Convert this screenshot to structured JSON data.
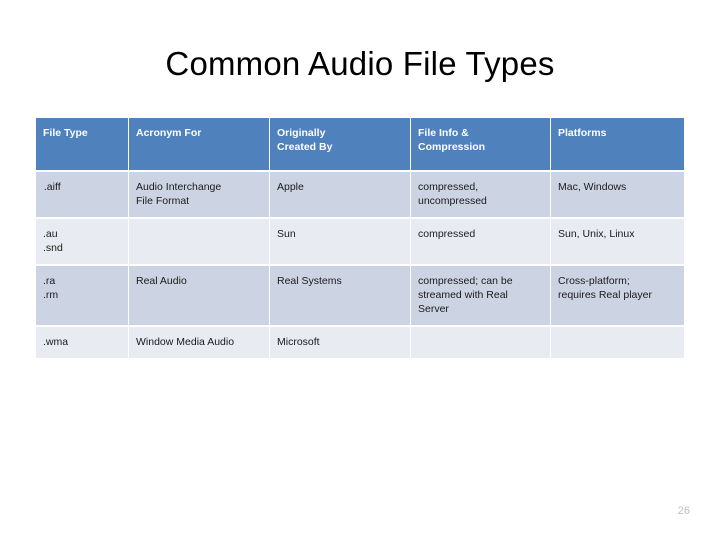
{
  "slide": {
    "title": "Common Audio File Types",
    "page_number": "26",
    "colors": {
      "header_blue": "#4f81bd",
      "row_dark": "#ccd4e4",
      "row_light": "#e8ebf2",
      "page_number_gray": "#bfbfbf",
      "background": "#ffffff"
    }
  },
  "table": {
    "headers": [
      "File Type",
      "Acronym For",
      "Originally Created By",
      "File Info & Compression",
      "Platforms"
    ],
    "header_lines": [
      [
        "File Type"
      ],
      [
        "Acronym For"
      ],
      [
        "Originally",
        "Created By"
      ],
      [
        "File Info &",
        "Compression"
      ],
      [
        "Platforms"
      ]
    ],
    "rows": [
      {
        "band": "dark",
        "cells": [
          [
            " .aiff"
          ],
          [
            "Audio Interchange",
            "File Format"
          ],
          [
            "Apple"
          ],
          [
            "compressed,",
            "uncompressed"
          ],
          [
            "Mac, Windows"
          ]
        ]
      },
      {
        "band": "light",
        "cells": [
          [
            ".au",
            ".snd"
          ],
          [
            ""
          ],
          [
            "Sun"
          ],
          [
            "compressed"
          ],
          [
            "Sun, Unix, Linux"
          ]
        ]
      },
      {
        "band": "dark",
        "cells": [
          [
            ".ra",
            ".rm"
          ],
          [
            "Real Audio"
          ],
          [
            "Real Systems"
          ],
          [
            "compressed; can be",
            "streamed with Real",
            "Server"
          ],
          [
            "Cross-platform;",
            "requires Real player"
          ]
        ]
      },
      {
        "band": "light",
        "cells": [
          [
            ".wma"
          ],
          [
            "Window Media Audio"
          ],
          [
            "Microsoft"
          ],
          [
            ""
          ],
          [
            ""
          ]
        ]
      }
    ]
  }
}
